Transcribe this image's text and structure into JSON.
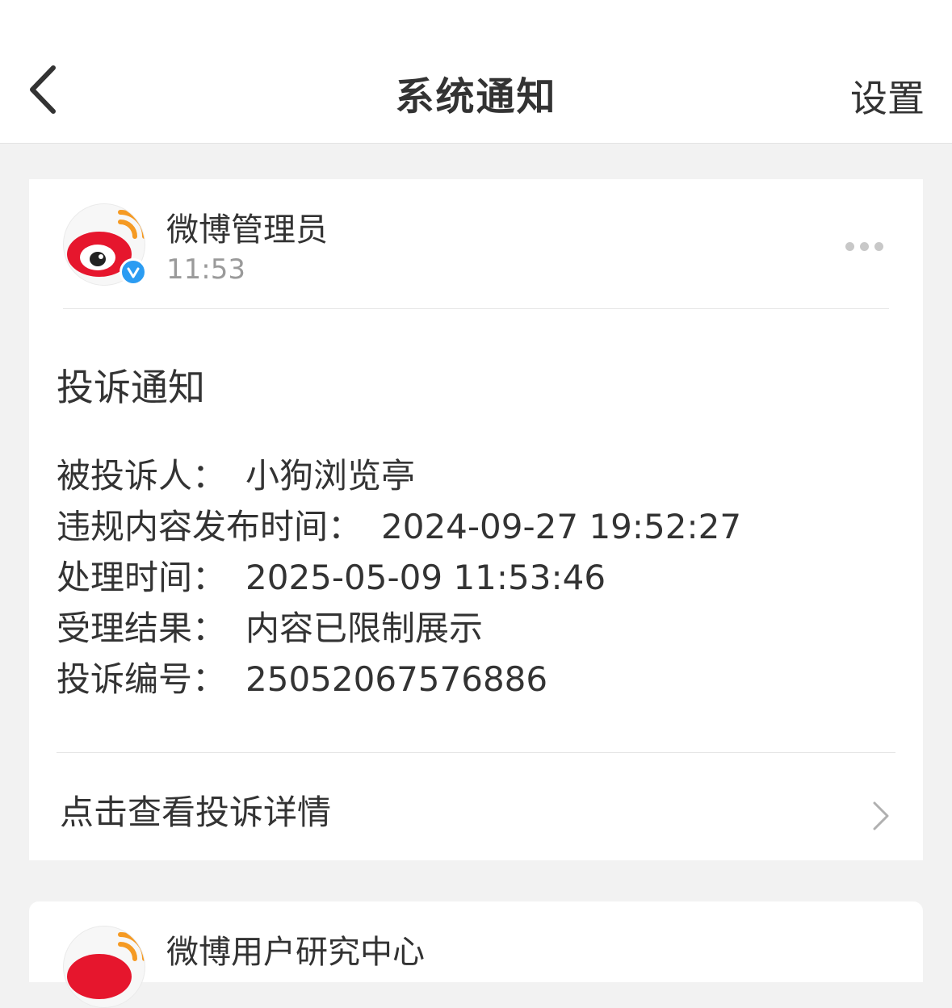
{
  "header": {
    "title": "系统通知",
    "settings_label": "设置",
    "back_icon": "chevron-left-icon"
  },
  "message": {
    "sender": "微博管理员",
    "time": "11:53",
    "title": "投诉通知",
    "fields": [
      {
        "label": "被投诉人：",
        "value": "小狗浏览亭"
      },
      {
        "label": "违规内容发布时间：",
        "value": "2024-09-27 19:52:27"
      },
      {
        "label": "处理时间：",
        "value": "2025-05-09 11:53:46"
      },
      {
        "label": "受理结果：",
        "value": "内容已限制展示"
      },
      {
        "label": "投诉编号：",
        "value": "25052067576886"
      }
    ],
    "detail_link": "点击查看投诉详情"
  },
  "next_message": {
    "sender": "微博用户研究中心"
  },
  "colors": {
    "weibo_red": "#e6162d",
    "weibo_orange": "#f59a23",
    "verified_blue": "#2b9cf2"
  }
}
